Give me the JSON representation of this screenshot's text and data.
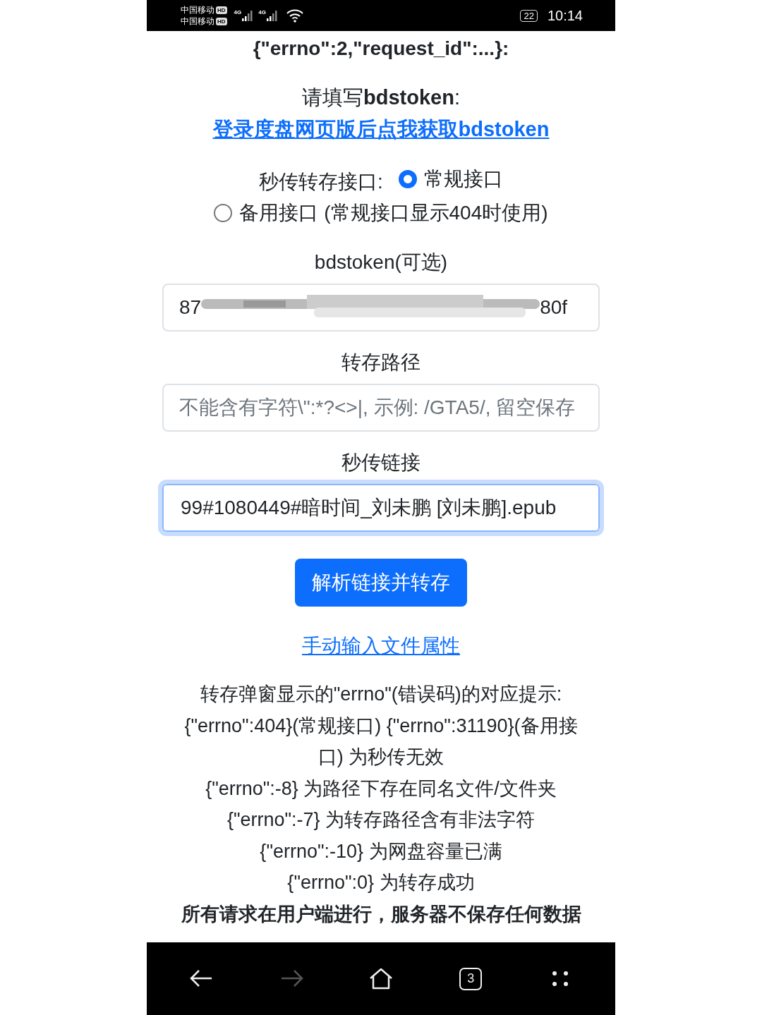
{
  "status_bar": {
    "carriers": [
      {
        "name": "中国移动",
        "badge": "HD"
      },
      {
        "name": "中国移动",
        "badge": "HD"
      }
    ],
    "networks": [
      "4G",
      "4G"
    ],
    "battery": "22",
    "time": "10:14"
  },
  "heading": "{\"errno\":2,\"request_id\":...}:",
  "bdstoken_prompt": {
    "label": "请填写**bdstoken**:",
    "link": "登录度盘网页版后点我获取bdstoken"
  },
  "api_choice": {
    "label": "秒传转存接口:",
    "options": [
      {
        "label": "常规接口",
        "selected": true
      },
      {
        "label": "备用接口 (常规接口显示404时使用)",
        "selected": false
      }
    ]
  },
  "fields": [
    {
      "label": "bdstoken(可选)",
      "value_start": "87",
      "value_end": "80f",
      "redacted": true,
      "focused": false
    },
    {
      "label": "转存路径",
      "placeholder": "不能含有字符\\\":*?<>|, 示例: /GTA5/, 留空保存",
      "focused": false
    },
    {
      "label": "秒传链接",
      "value": "99#1080449#暗时间_刘未鹏 [刘未鹏].epub",
      "focused": true
    }
  ],
  "submit_button": "解析链接并转存",
  "manual_link": "手动输入文件属性",
  "notes": [
    "转存弹窗显示的\"errno\"(错误码)的对应提示:",
    "{\"errno\":404}(常规接口) {\"errno\":31190}(备用接口) 为秒传无效",
    "{\"errno\":-8} 为路径下存在同名文件/文件夹",
    "{\"errno\":-7} 为转存路径含有非法字符",
    "{\"errno\":-10} 为网盘容量已满",
    "{\"errno\":0} 为转存成功"
  ],
  "disclaimer": "所有请求在用户端进行，服务器不保存任何数据",
  "nav_bar": [
    {
      "kind": "back",
      "disabled": false
    },
    {
      "kind": "forward",
      "disabled": true
    },
    {
      "kind": "home",
      "disabled": false
    },
    {
      "kind": "tabs",
      "label": "3",
      "disabled": false
    },
    {
      "kind": "menu",
      "disabled": false
    }
  ]
}
